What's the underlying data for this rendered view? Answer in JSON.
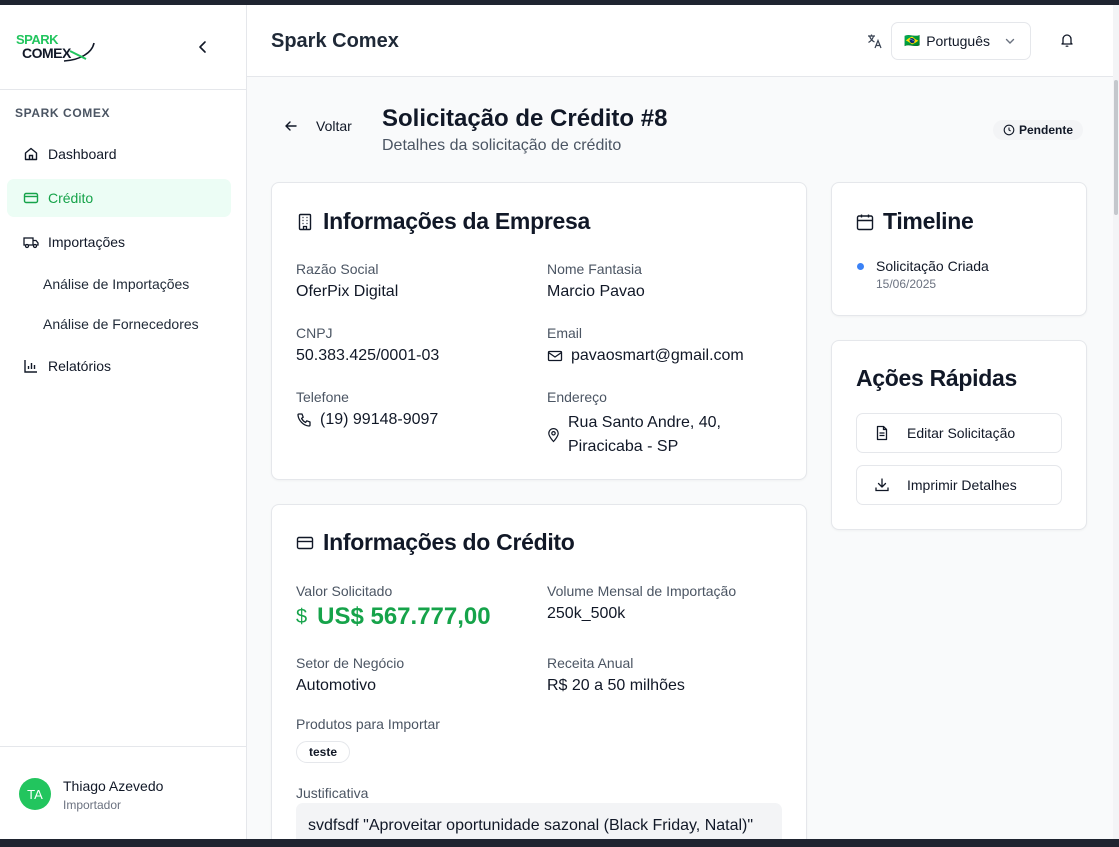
{
  "sidebar": {
    "logo_top": "SPARK",
    "logo_bottom": "COMEX",
    "section_label": "SPARK COMEX",
    "items": [
      {
        "label": "Dashboard",
        "icon": "home-icon"
      },
      {
        "label": "Crédito",
        "icon": "credit-card-icon",
        "active": true
      },
      {
        "label": "Importações",
        "icon": "truck-icon"
      }
    ],
    "sub_items": [
      {
        "label": "Análise de Importações"
      },
      {
        "label": "Análise de Fornecedores"
      }
    ],
    "reports": {
      "label": "Relatórios",
      "icon": "bar-chart-icon"
    },
    "user": {
      "initials": "TA",
      "name": "Thiago Azevedo",
      "role": "Importador"
    }
  },
  "header": {
    "title": "Spark Comex",
    "language": {
      "flag": "🇧🇷",
      "label": "Português"
    }
  },
  "page": {
    "back_label": "Voltar",
    "title": "Solicitação de Crédito #8",
    "subtitle": "Detalhes da solicitação de crédito",
    "status": "Pendente"
  },
  "company": {
    "title": "Informações da Empresa",
    "razao_label": "Razão Social",
    "razao_value": "OferPix Digital",
    "fantasia_label": "Nome Fantasia",
    "fantasia_value": "Marcio Pavao",
    "cnpj_label": "CNPJ",
    "cnpj_value": "50.383.425/0001-03",
    "email_label": "Email",
    "email_value": "pavaosmart@gmail.com",
    "phone_label": "Telefone",
    "phone_value": "(19) 99148-9097",
    "address_label": "Endereço",
    "address_line1": "Rua Santo Andre, 40,",
    "address_line2": "Piracicaba - SP"
  },
  "credit": {
    "title": "Informações do Crédito",
    "valor_label": "Valor Solicitado",
    "valor_symbol": "$",
    "valor_value": "US$ 567.777,00",
    "volume_label": "Volume Mensal de Importação",
    "volume_value": "250k_500k",
    "setor_label": "Setor de Negócio",
    "setor_value": "Automotivo",
    "receita_label": "Receita Anual",
    "receita_value": "R$ 20 a 50 milhões",
    "produtos_label": "Produtos para Importar",
    "produtos": [
      "teste"
    ],
    "justificativa_label": "Justificativa",
    "justificativa_value": "svdfsdf \"Aproveitar oportunidade sazonal (Black Friday, Natal)\""
  },
  "timeline": {
    "title": "Timeline",
    "events": [
      {
        "title": "Solicitação Criada",
        "date": "15/06/2025"
      }
    ]
  },
  "quick_actions": {
    "title": "Ações Rápidas",
    "edit_label": "Editar Solicitação",
    "print_label": "Imprimir Detalhes"
  },
  "colors": {
    "accent_green": "#16a34a",
    "active_bg": "#ecfdf5",
    "timeline_dot": "#3b82f6",
    "avatar_bg": "#22c55e"
  }
}
